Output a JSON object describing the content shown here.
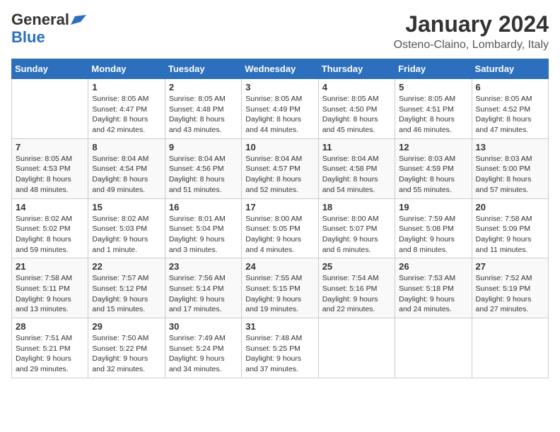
{
  "header": {
    "logo_line1": "General",
    "logo_line2": "Blue",
    "month_title": "January 2024",
    "location": "Osteno-Claino, Lombardy, Italy"
  },
  "weekdays": [
    "Sunday",
    "Monday",
    "Tuesday",
    "Wednesday",
    "Thursday",
    "Friday",
    "Saturday"
  ],
  "weeks": [
    [
      {
        "day": "",
        "info": ""
      },
      {
        "day": "1",
        "info": "Sunrise: 8:05 AM\nSunset: 4:47 PM\nDaylight: 8 hours\nand 42 minutes."
      },
      {
        "day": "2",
        "info": "Sunrise: 8:05 AM\nSunset: 4:48 PM\nDaylight: 8 hours\nand 43 minutes."
      },
      {
        "day": "3",
        "info": "Sunrise: 8:05 AM\nSunset: 4:49 PM\nDaylight: 8 hours\nand 44 minutes."
      },
      {
        "day": "4",
        "info": "Sunrise: 8:05 AM\nSunset: 4:50 PM\nDaylight: 8 hours\nand 45 minutes."
      },
      {
        "day": "5",
        "info": "Sunrise: 8:05 AM\nSunset: 4:51 PM\nDaylight: 8 hours\nand 46 minutes."
      },
      {
        "day": "6",
        "info": "Sunrise: 8:05 AM\nSunset: 4:52 PM\nDaylight: 8 hours\nand 47 minutes."
      }
    ],
    [
      {
        "day": "7",
        "info": "Sunrise: 8:05 AM\nSunset: 4:53 PM\nDaylight: 8 hours\nand 48 minutes."
      },
      {
        "day": "8",
        "info": "Sunrise: 8:04 AM\nSunset: 4:54 PM\nDaylight: 8 hours\nand 49 minutes."
      },
      {
        "day": "9",
        "info": "Sunrise: 8:04 AM\nSunset: 4:56 PM\nDaylight: 8 hours\nand 51 minutes."
      },
      {
        "day": "10",
        "info": "Sunrise: 8:04 AM\nSunset: 4:57 PM\nDaylight: 8 hours\nand 52 minutes."
      },
      {
        "day": "11",
        "info": "Sunrise: 8:04 AM\nSunset: 4:58 PM\nDaylight: 8 hours\nand 54 minutes."
      },
      {
        "day": "12",
        "info": "Sunrise: 8:03 AM\nSunset: 4:59 PM\nDaylight: 8 hours\nand 55 minutes."
      },
      {
        "day": "13",
        "info": "Sunrise: 8:03 AM\nSunset: 5:00 PM\nDaylight: 8 hours\nand 57 minutes."
      }
    ],
    [
      {
        "day": "14",
        "info": "Sunrise: 8:02 AM\nSunset: 5:02 PM\nDaylight: 8 hours\nand 59 minutes."
      },
      {
        "day": "15",
        "info": "Sunrise: 8:02 AM\nSunset: 5:03 PM\nDaylight: 9 hours\nand 1 minute."
      },
      {
        "day": "16",
        "info": "Sunrise: 8:01 AM\nSunset: 5:04 PM\nDaylight: 9 hours\nand 3 minutes."
      },
      {
        "day": "17",
        "info": "Sunrise: 8:00 AM\nSunset: 5:05 PM\nDaylight: 9 hours\nand 4 minutes."
      },
      {
        "day": "18",
        "info": "Sunrise: 8:00 AM\nSunset: 5:07 PM\nDaylight: 9 hours\nand 6 minutes."
      },
      {
        "day": "19",
        "info": "Sunrise: 7:59 AM\nSunset: 5:08 PM\nDaylight: 9 hours\nand 8 minutes."
      },
      {
        "day": "20",
        "info": "Sunrise: 7:58 AM\nSunset: 5:09 PM\nDaylight: 9 hours\nand 11 minutes."
      }
    ],
    [
      {
        "day": "21",
        "info": "Sunrise: 7:58 AM\nSunset: 5:11 PM\nDaylight: 9 hours\nand 13 minutes."
      },
      {
        "day": "22",
        "info": "Sunrise: 7:57 AM\nSunset: 5:12 PM\nDaylight: 9 hours\nand 15 minutes."
      },
      {
        "day": "23",
        "info": "Sunrise: 7:56 AM\nSunset: 5:14 PM\nDaylight: 9 hours\nand 17 minutes."
      },
      {
        "day": "24",
        "info": "Sunrise: 7:55 AM\nSunset: 5:15 PM\nDaylight: 9 hours\nand 19 minutes."
      },
      {
        "day": "25",
        "info": "Sunrise: 7:54 AM\nSunset: 5:16 PM\nDaylight: 9 hours\nand 22 minutes."
      },
      {
        "day": "26",
        "info": "Sunrise: 7:53 AM\nSunset: 5:18 PM\nDaylight: 9 hours\nand 24 minutes."
      },
      {
        "day": "27",
        "info": "Sunrise: 7:52 AM\nSunset: 5:19 PM\nDaylight: 9 hours\nand 27 minutes."
      }
    ],
    [
      {
        "day": "28",
        "info": "Sunrise: 7:51 AM\nSunset: 5:21 PM\nDaylight: 9 hours\nand 29 minutes."
      },
      {
        "day": "29",
        "info": "Sunrise: 7:50 AM\nSunset: 5:22 PM\nDaylight: 9 hours\nand 32 minutes."
      },
      {
        "day": "30",
        "info": "Sunrise: 7:49 AM\nSunset: 5:24 PM\nDaylight: 9 hours\nand 34 minutes."
      },
      {
        "day": "31",
        "info": "Sunrise: 7:48 AM\nSunset: 5:25 PM\nDaylight: 9 hours\nand 37 minutes."
      },
      {
        "day": "",
        "info": ""
      },
      {
        "day": "",
        "info": ""
      },
      {
        "day": "",
        "info": ""
      }
    ]
  ]
}
